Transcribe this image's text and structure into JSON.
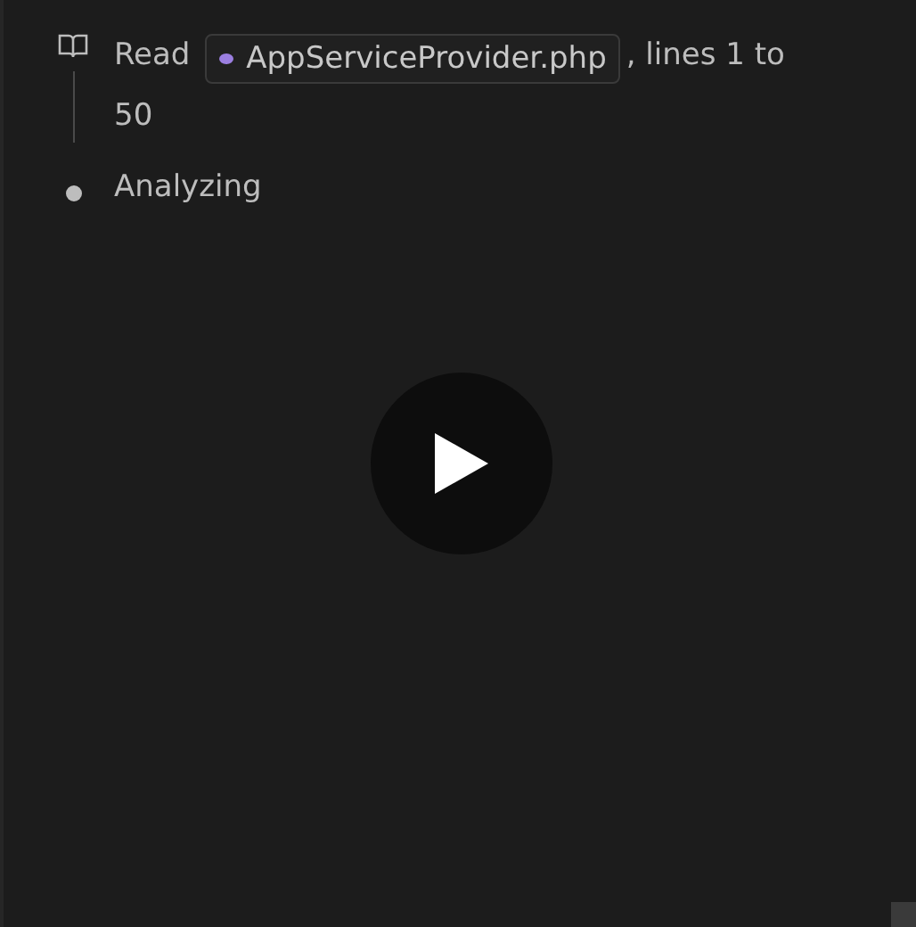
{
  "steps": [
    {
      "kind": "read",
      "verb": "Read",
      "file": "AppServiceProvider.php",
      "suffix_lines": [
        ", lines 1 to",
        "50"
      ]
    },
    {
      "kind": "status",
      "label": "Analyzing"
    }
  ]
}
